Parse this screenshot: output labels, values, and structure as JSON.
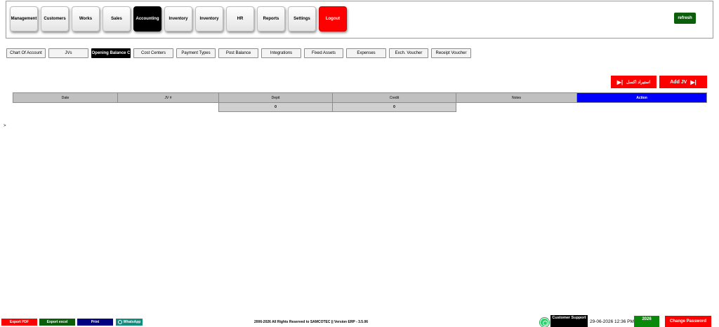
{
  "nav": {
    "items": [
      {
        "label": "Management"
      },
      {
        "label": "Customers"
      },
      {
        "label": "Works"
      },
      {
        "label": "Sales"
      },
      {
        "label": "Accounting",
        "active": true
      },
      {
        "label": "Inventory"
      },
      {
        "label": "Inventory"
      },
      {
        "label": "HR"
      },
      {
        "label": "Reports"
      },
      {
        "label": "Settings"
      },
      {
        "label": "Logout"
      }
    ],
    "refresh_label": "refresh"
  },
  "tabs": [
    {
      "label": "Chart Of Account"
    },
    {
      "label": "JVs"
    },
    {
      "label": "Opening Balance C",
      "active": true
    },
    {
      "label": "Cost Centers"
    },
    {
      "label": "Payment Types"
    },
    {
      "label": "Post Balance"
    },
    {
      "label": "Integrations"
    },
    {
      "label": "Fixed Assets"
    },
    {
      "label": "Expenses"
    },
    {
      "label": "Exch. Voucher"
    },
    {
      "label": "Receipt Voucher"
    }
  ],
  "actions": {
    "import_label": "استيراد اكسل",
    "add_jv_label": "Add JV"
  },
  "table": {
    "columns": [
      "Date",
      "JV #",
      "Depit",
      "Credit",
      "Notes",
      "Action"
    ],
    "totals": {
      "depit": "0",
      "credit": "0"
    }
  },
  "caret": ">",
  "footer": {
    "export_pdf": "Export PDF",
    "export_excel": "Export excel",
    "print": "Print",
    "whatsapp": "WhatsApp",
    "copyright": "2006-2026 All Rights Reserved to SAMCOTEC || Version ERP - 3.5.06",
    "support": "Customer Support",
    "datetime": "29-06-2026 12:36 PM",
    "year": "2026",
    "change_password": "Change Password"
  },
  "colors": {
    "active": "#000000",
    "danger": "#ff0000",
    "refresh": "#0b5f0b",
    "action_header": "#0000ff",
    "year_badge": "#0a8a0a"
  }
}
